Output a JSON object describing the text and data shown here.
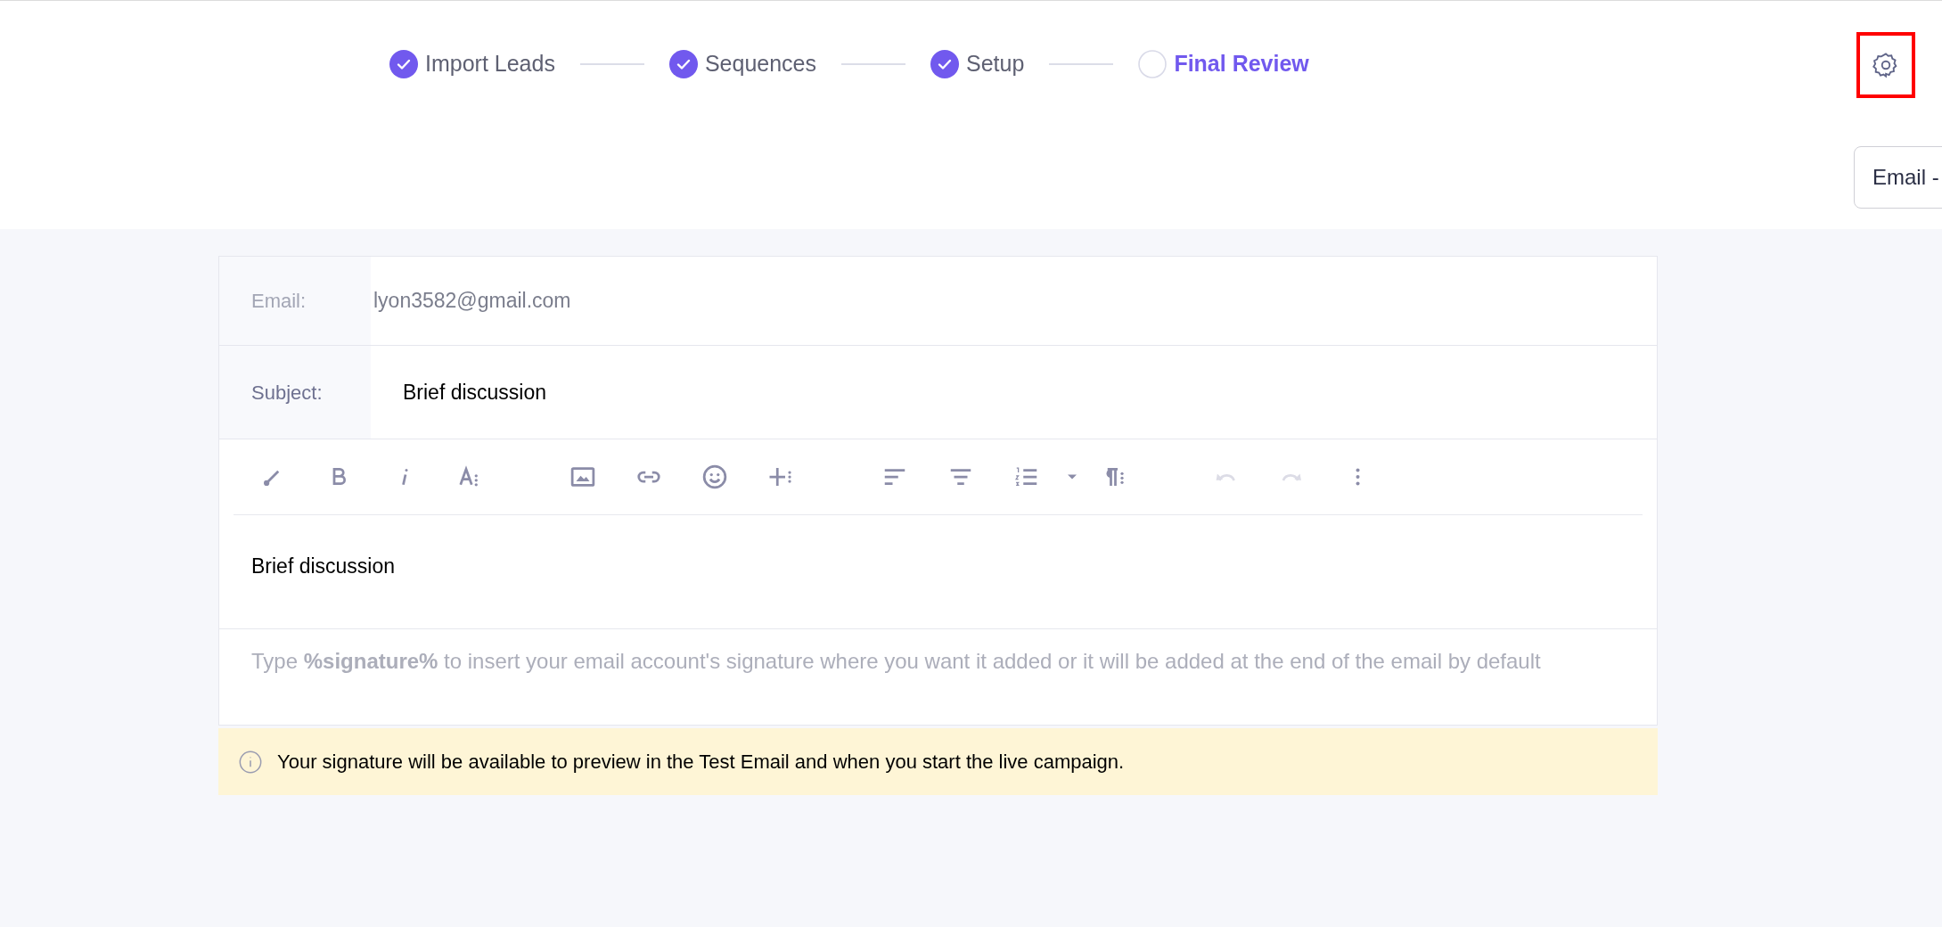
{
  "stepper": {
    "steps": [
      {
        "label": "Import Leads",
        "completed": true,
        "selected": false
      },
      {
        "label": "Sequences",
        "completed": true,
        "selected": false
      },
      {
        "label": "Setup",
        "completed": true,
        "selected": false
      },
      {
        "label": "Final Review",
        "completed": false,
        "selected": true
      }
    ]
  },
  "settings": {
    "highlighted": true
  },
  "view_select": {
    "value": "Email -"
  },
  "email_form": {
    "email_label": "Email:",
    "email_value": "lyon3582@gmail.com",
    "subject_label": "Subject:",
    "subject_value": "Brief discussion",
    "toolbar": [
      {
        "kind": "brush",
        "disabled": false
      },
      {
        "kind": "bold",
        "disabled": false
      },
      {
        "kind": "italic",
        "disabled": false
      },
      {
        "kind": "font-size",
        "disabled": false
      },
      {
        "kind": "image",
        "disabled": false
      },
      {
        "kind": "link",
        "disabled": false
      },
      {
        "kind": "emoji",
        "disabled": false
      },
      {
        "kind": "insert",
        "disabled": false
      },
      {
        "kind": "align-left",
        "disabled": false
      },
      {
        "kind": "align-center",
        "disabled": false
      },
      {
        "kind": "numbered-list",
        "disabled": false
      },
      {
        "kind": "dropdown",
        "disabled": false
      },
      {
        "kind": "paragraph",
        "disabled": false
      },
      {
        "kind": "undo",
        "disabled": true
      },
      {
        "kind": "redo",
        "disabled": true
      },
      {
        "kind": "more",
        "disabled": false
      }
    ],
    "body": "Brief discussion",
    "signature_hint": "Type **%signature%** to insert your email account's signature where you want it added or it will be added at the end of the email by default"
  },
  "notice": {
    "text": "Your signature will be available to preview in the Test Email and when you start the live campaign."
  }
}
